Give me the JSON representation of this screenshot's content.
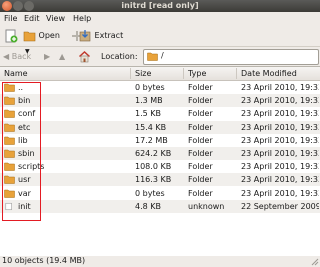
{
  "window": {
    "title": "initrd [read only]"
  },
  "menu": [
    "File",
    "Edit",
    "View",
    "Help"
  ],
  "toolbar": {
    "open_label": "Open",
    "extract_label": "Extract"
  },
  "location": {
    "back_label": "Back",
    "label": "Location:",
    "path": "/"
  },
  "columns": {
    "name": "Name",
    "size": "Size",
    "type": "Type",
    "date": "Date Modified"
  },
  "files": [
    {
      "name": "..",
      "size": "0 bytes",
      "type": "Folder",
      "date": "23 April 2010, 19:33",
      "kind": "folder"
    },
    {
      "name": "bin",
      "size": "1.3 MB",
      "type": "Folder",
      "date": "23 April 2010, 19:33",
      "kind": "folder"
    },
    {
      "name": "conf",
      "size": "1.5 KB",
      "type": "Folder",
      "date": "23 April 2010, 19:33",
      "kind": "folder"
    },
    {
      "name": "etc",
      "size": "15.4 KB",
      "type": "Folder",
      "date": "23 April 2010, 19:33",
      "kind": "folder"
    },
    {
      "name": "lib",
      "size": "17.2 MB",
      "type": "Folder",
      "date": "23 April 2010, 19:33",
      "kind": "folder"
    },
    {
      "name": "sbin",
      "size": "624.2 KB",
      "type": "Folder",
      "date": "23 April 2010, 19:33",
      "kind": "folder"
    },
    {
      "name": "scripts",
      "size": "108.0 KB",
      "type": "Folder",
      "date": "23 April 2010, 19:33",
      "kind": "folder"
    },
    {
      "name": "usr",
      "size": "116.3 KB",
      "type": "Folder",
      "date": "23 April 2010, 19:33",
      "kind": "folder"
    },
    {
      "name": "var",
      "size": "0 bytes",
      "type": "Folder",
      "date": "23 April 2010, 19:33",
      "kind": "folder"
    },
    {
      "name": "init",
      "size": "4.8 KB",
      "type": "unknown",
      "date": "22 September 2009...",
      "kind": "file"
    }
  ],
  "status": "10 objects (19.4 MB)",
  "colors": {
    "folder": "#e8a23a",
    "highlight_box": "#e31b23",
    "titlebar": "#3c3b37"
  }
}
